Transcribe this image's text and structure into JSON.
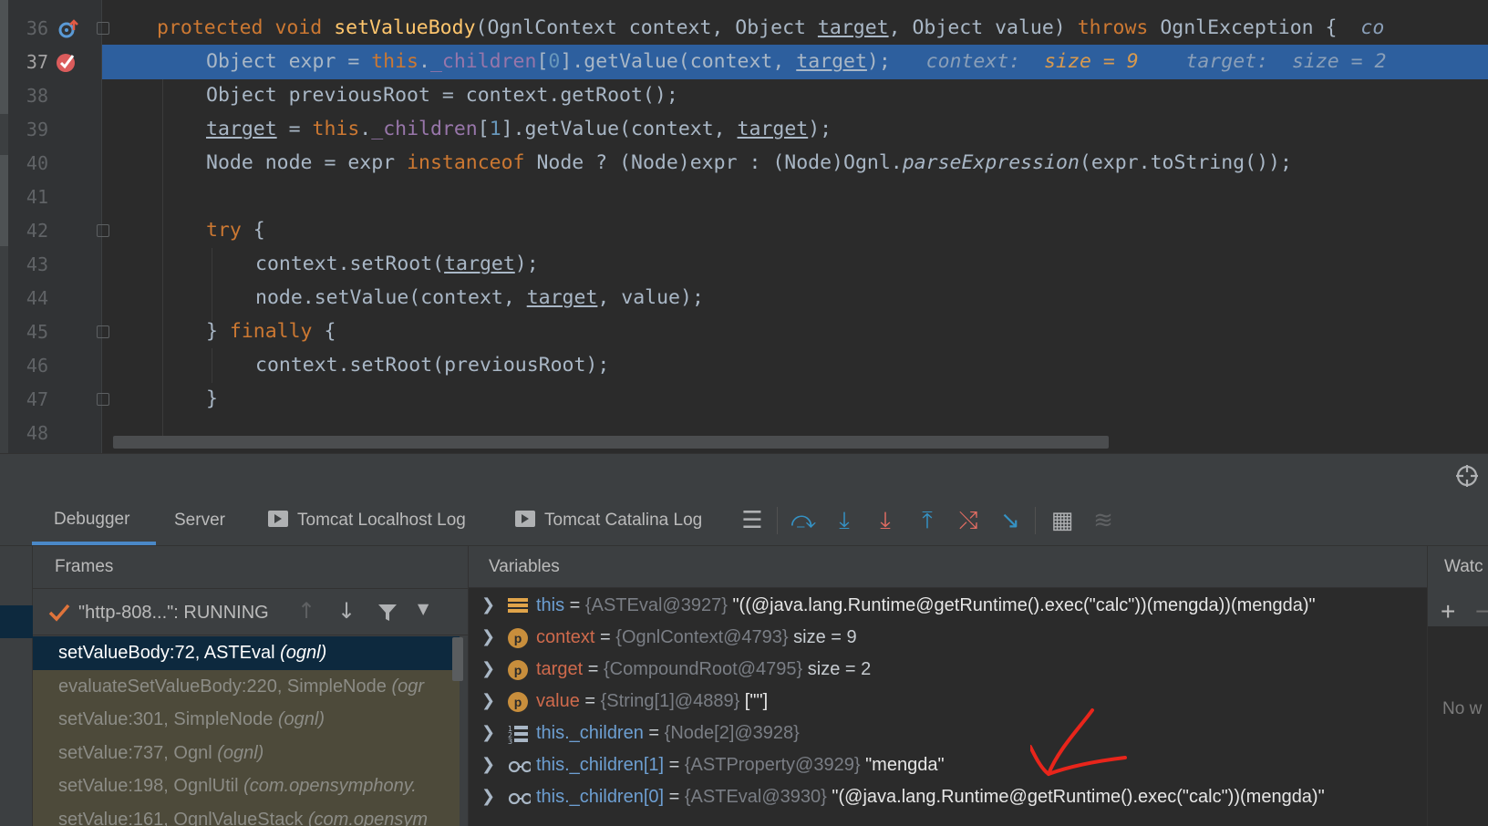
{
  "editor": {
    "lines": [
      {
        "num": "36",
        "marker": "override"
      },
      {
        "num": "37",
        "marker": "breakpoint",
        "current": true
      },
      {
        "num": "38"
      },
      {
        "num": "39"
      },
      {
        "num": "40"
      },
      {
        "num": "41"
      },
      {
        "num": "42"
      },
      {
        "num": "43"
      },
      {
        "num": "44"
      },
      {
        "num": "45"
      },
      {
        "num": "46"
      },
      {
        "num": "47"
      },
      {
        "num": "48"
      }
    ],
    "code": {
      "l36_kw1": "protected",
      "l36_kw2": "void",
      "l36_fn": "setValueBody",
      "l36_a": "(OgnlContext context, Object ",
      "l36_p1": "target",
      "l36_b": ", Object value) ",
      "l36_kw3": "throws",
      "l36_c": " OgnlException {",
      "l36_hint": "co",
      "l37_a": "Object expr = ",
      "l37_this": "this",
      "l37_dot": ".",
      "l37_fld": "_children",
      "l37_b": "[",
      "l37_num": "0",
      "l37_c": "].getValue(context, ",
      "l37_p": "target",
      "l37_d": ");",
      "l37_hint1": "context:",
      "l37_hint1v": "size = 9",
      "l37_hint2": "target:",
      "l37_hint2v": "size = 2",
      "l38": "Object previousRoot = context.getRoot();",
      "l39_p1": "target",
      "l39_a": " = ",
      "l39_this": "this",
      "l39_dot": ".",
      "l39_fld": "_children",
      "l39_b": "[",
      "l39_num": "1",
      "l39_c": "].getValue(context, ",
      "l39_p2": "target",
      "l39_d": ");",
      "l40_a": "Node node = expr ",
      "l40_kw": "instanceof",
      "l40_b": " Node ? (Node)expr : (Node)Ognl.",
      "l40_it": "parseExpression",
      "l40_c": "(expr.toString());",
      "l42_kw": "try",
      "l42_a": " {",
      "l43_a": "context.setRoot(",
      "l43_p": "target",
      "l43_b": ");",
      "l44_a": "node.setValue(context, ",
      "l44_p": "target",
      "l44_b": ", value);",
      "l45_a": "} ",
      "l45_kw": "finally",
      "l45_b": " {",
      "l46": "context.setRoot(previousRoot);",
      "l47": "}"
    }
  },
  "toolwindow": {
    "tabs": [
      "Debugger",
      "Server",
      "Tomcat Localhost Log",
      "Tomcat Catalina Log"
    ],
    "toolbar_icons": [
      "show-execution-point-icon",
      "step-over-icon",
      "step-into-icon",
      "force-step-into-icon",
      "step-out-icon",
      "drop-frame-icon",
      "run-to-cursor-icon",
      "evaluate-expression-icon",
      "trace-current-stream-icon"
    ]
  },
  "frames": {
    "title": "Frames",
    "thread": "\"http-808...\": RUNNING",
    "items": [
      {
        "method": "setValueBody:72, ASTEval ",
        "pkg": "(ognl)"
      },
      {
        "method": "evaluateSetValueBody:220, SimpleNode ",
        "pkg": "(ogr"
      },
      {
        "method": "setValue:301, SimpleNode ",
        "pkg": "(ognl)"
      },
      {
        "method": "setValue:737, Ognl ",
        "pkg": "(ognl)"
      },
      {
        "method": "setValue:198, OgnlUtil ",
        "pkg": "(com.opensymphony."
      },
      {
        "method": "setValue:161, OgnlValueStack ",
        "pkg": "(com.opensym"
      }
    ]
  },
  "variables": {
    "title": "Variables",
    "items": [
      {
        "icon": "field-bars-icon",
        "name": "this",
        "eq": " = ",
        "type": "{ASTEval@3927}",
        "val": " \"((@java.lang.Runtime@getRuntime().exec(\"calc\"))(mengda))(mengda)\""
      },
      {
        "icon": "parameter-icon",
        "name": "context",
        "eq": " = ",
        "type": "{OgnlContext@4793}",
        "val": "  size = 9"
      },
      {
        "icon": "parameter-icon",
        "name": "target",
        "eq": " = ",
        "type": "{CompoundRoot@4795}",
        "val": "  size = 2"
      },
      {
        "icon": "parameter-icon",
        "name": "value",
        "eq": " = ",
        "type": "{String[1]@4889}",
        "val": " [\"\"]"
      },
      {
        "icon": "array-icon",
        "name": "this._children",
        "eq": " = ",
        "type": "{Node[2]@3928}",
        "val": ""
      },
      {
        "icon": "watch-glasses-icon",
        "name": "this._children[1]",
        "eq": " = ",
        "type": "{ASTProperty@3929}",
        "val": " \"mengda\""
      },
      {
        "icon": "watch-glasses-icon",
        "name": "this._children[0]",
        "eq": " = ",
        "type": "{ASTEval@3930}",
        "val": " \"(@java.lang.Runtime@getRuntime().exec(\"calc\"))(mengda)\""
      }
    ],
    "param_letter": "p"
  },
  "watches": {
    "title": "Watc",
    "add": "+",
    "remove": "−",
    "empty": "No w"
  },
  "colors": {
    "accent": "#2d5f9e",
    "annotation": "#e8251b"
  }
}
